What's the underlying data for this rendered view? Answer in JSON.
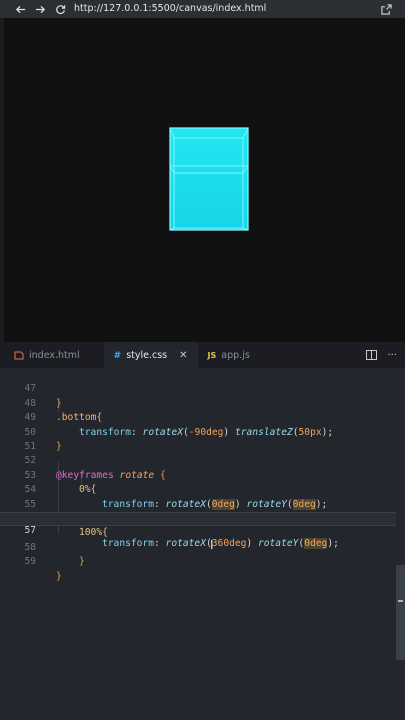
{
  "browser": {
    "url": "http://127.0.0.1:5500/canvas/index.html"
  },
  "scene": {
    "cube_color": "#1fe2f0",
    "background": "#111111"
  },
  "tabs": [
    {
      "label": "index.html",
      "icon": "html-icon",
      "active": false
    },
    {
      "label": "style.css",
      "icon": "css-icon",
      "icon_text": "#",
      "active": true
    },
    {
      "label": "app.js",
      "icon": "js-icon",
      "icon_text": "JS",
      "active": false
    }
  ],
  "code": {
    "lines": [
      {
        "n": "47",
        "text": "}"
      },
      {
        "n": "48",
        "text": ".bottom{"
      },
      {
        "n": "49",
        "text": "transform: rotateX(-90deg) translateZ(50px);"
      },
      {
        "n": "50",
        "text": "}"
      },
      {
        "n": "51",
        "text": ""
      },
      {
        "n": "52",
        "text": "@keyframes rotate {"
      },
      {
        "n": "53",
        "text": "0%{"
      },
      {
        "n": "54",
        "text": "transform: rotateX(0deg) rotateY(0deg);"
      },
      {
        "n": "55",
        "text": "}"
      },
      {
        "n": "56",
        "text": "100%{"
      },
      {
        "n": "57",
        "text": "transform: rotateX(360deg) rotateY(0deg);"
      },
      {
        "n": "58",
        "text": "}"
      },
      {
        "n": "59",
        "text": "}"
      }
    ],
    "current_line": "57"
  }
}
